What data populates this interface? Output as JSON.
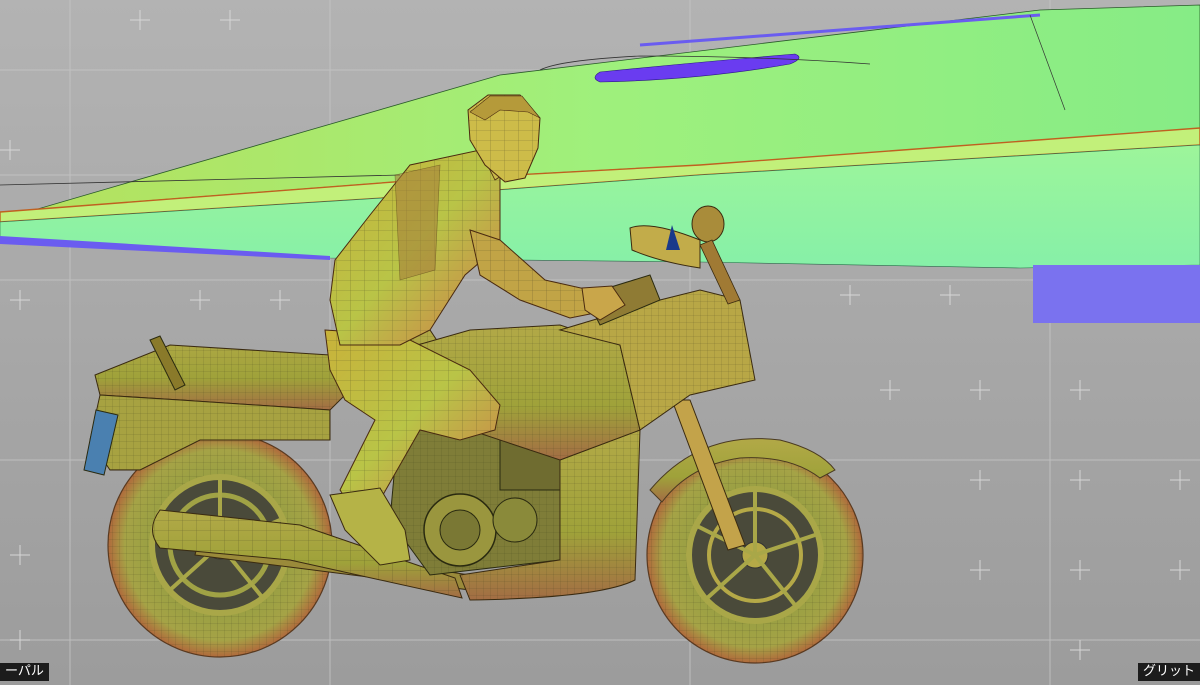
{
  "viewport": {
    "left_label": "ーパル",
    "right_label": "グリット"
  },
  "scene": {
    "objects": [
      {
        "name": "aircraft-wing",
        "color": "#8fef7a"
      },
      {
        "name": "rider",
        "color": "#b7b53a"
      },
      {
        "name": "motorcycle",
        "color": "#9ea43a"
      }
    ],
    "accent_colors": {
      "wing": "#8fef7a",
      "wing_edge": "#d96a1c",
      "wing_underside": "#6a5cf0",
      "rider": "#b7b53a",
      "bike": "#9ea43a",
      "grid": "#c9c9c9"
    }
  }
}
